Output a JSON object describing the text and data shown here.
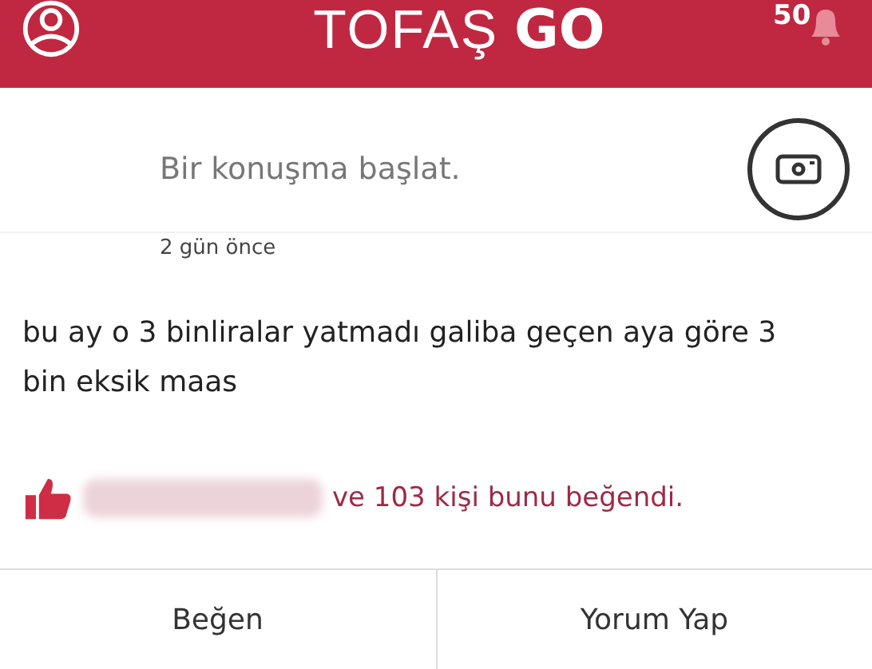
{
  "header": {
    "logo_light": "TOFAŞ",
    "logo_bold": "GO",
    "notification_count": "50"
  },
  "composer": {
    "placeholder": "Bir konuşma başlat."
  },
  "post": {
    "time": "2 gün önce",
    "text": "bu ay o 3 binliralar yatmadı galiba geçen aya göre 3 bin eksik maas",
    "likes": "ve 103 kişi bunu beğendi."
  },
  "actions": [
    {
      "label": "Beğen"
    },
    {
      "label": "Yorum Yap"
    }
  ]
}
